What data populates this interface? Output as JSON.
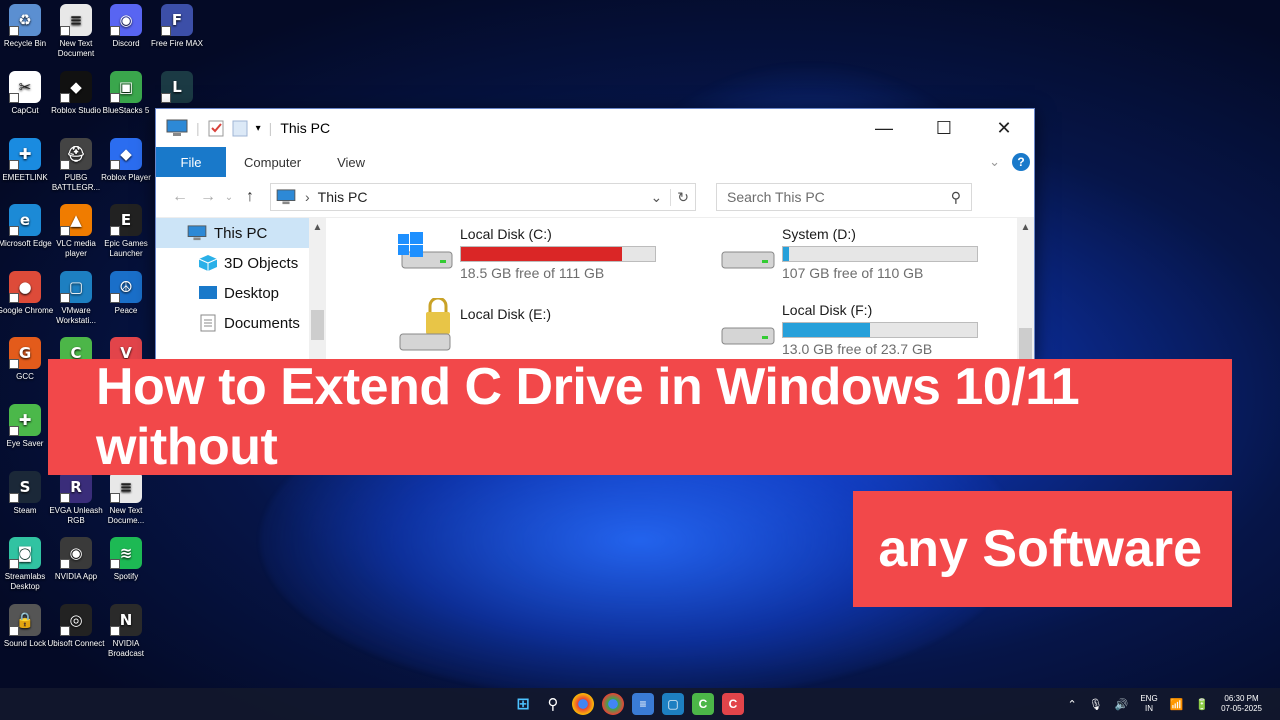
{
  "desktop": {
    "icons": [
      {
        "label": "Recycle Bin",
        "icon": "recycle-bin-icon",
        "color": "#5b8fd1",
        "glyph": "♻"
      },
      {
        "label": "New Text Document",
        "icon": "text-document-icon",
        "color": "#e8e8e8",
        "glyph": "≡"
      },
      {
        "label": "Discord",
        "icon": "discord-icon",
        "color": "#5865f2",
        "glyph": "◉"
      },
      {
        "label": "Free Fire MAX",
        "icon": "free-fire-icon",
        "color": "#3c4fa8",
        "glyph": "F"
      },
      {
        "label": "CapCut",
        "icon": "capcut-icon",
        "color": "#ffffff",
        "glyph": "✂"
      },
      {
        "label": "Roblox Studio",
        "icon": "roblox-studio-icon",
        "color": "#111111",
        "glyph": "◆"
      },
      {
        "label": "BlueStacks 5",
        "icon": "bluestacks-icon",
        "color": "#3aa64c",
        "glyph": "▣"
      },
      {
        "label": "",
        "icon": "league-icon",
        "color": "#1b3a44",
        "glyph": "L"
      },
      {
        "label": "EMEETLINK",
        "icon": "emeetlink-icon",
        "color": "#1a8be0",
        "glyph": "✚"
      },
      {
        "label": "PUBG BATTLEGR...",
        "icon": "pubg-icon",
        "color": "#444444",
        "glyph": "⛑"
      },
      {
        "label": "Roblox Player",
        "icon": "roblox-player-icon",
        "color": "#2b6df0",
        "glyph": "◆"
      },
      {
        "label": "Microsoft Edge",
        "icon": "edge-icon",
        "color": "#1c8ad6",
        "glyph": "e"
      },
      {
        "label": "VLC media player",
        "icon": "vlc-icon",
        "color": "#f07c00",
        "glyph": "▲"
      },
      {
        "label": "Epic Games Launcher",
        "icon": "epic-games-icon",
        "color": "#222222",
        "glyph": "E"
      },
      {
        "label": "Google Chrome",
        "icon": "chrome-icon",
        "color": "#dd4b39",
        "glyph": "●"
      },
      {
        "label": "VMware Workstati...",
        "icon": "vmware-icon",
        "color": "#1d7fc1",
        "glyph": "▢"
      },
      {
        "label": "Peace",
        "icon": "peace-icon",
        "color": "#1a6fc9",
        "glyph": "☮"
      },
      {
        "label": "GCC",
        "icon": "gcc-icon",
        "color": "#e35b1b",
        "glyph": "G"
      },
      {
        "label": "",
        "icon": "camtasia-icon",
        "color": "#4cb648",
        "glyph": "C"
      },
      {
        "label": "",
        "icon": "valorant-icon",
        "color": "#e2444a",
        "glyph": "V"
      },
      {
        "label": "Eye Saver",
        "icon": "eye-saver-icon",
        "color": "#4bb84a",
        "glyph": "✚"
      },
      {
        "label": "Steam",
        "icon": "steam-icon",
        "color": "#1b2838",
        "glyph": "S"
      },
      {
        "label": "EVGA Unleash RGB",
        "icon": "evga-icon",
        "color": "#3a2d7a",
        "glyph": "R"
      },
      {
        "label": "New Text Docume...",
        "icon": "text-document-icon",
        "color": "#e8e8e8",
        "glyph": "≡"
      },
      {
        "label": "Streamlabs Desktop",
        "icon": "streamlabs-icon",
        "color": "#31c3a2",
        "glyph": "◙"
      },
      {
        "label": "NVIDIA App",
        "icon": "nvidia-icon",
        "color": "#3a3a3a",
        "glyph": "◉"
      },
      {
        "label": "Spotify",
        "icon": "spotify-icon",
        "color": "#1db954",
        "glyph": "≋"
      },
      {
        "label": "Sound Lock",
        "icon": "sound-lock-icon",
        "color": "#555555",
        "glyph": "🔒"
      },
      {
        "label": "Ubisoft Connect",
        "icon": "ubisoft-icon",
        "color": "#222222",
        "glyph": "◎"
      },
      {
        "label": "NVIDIA Broadcast",
        "icon": "nvidia-broadcast-icon",
        "color": "#2a2a2a",
        "glyph": "N"
      }
    ]
  },
  "explorer": {
    "title": "This PC",
    "ribbon": {
      "file": "File",
      "computer": "Computer",
      "view": "View",
      "help": "?"
    },
    "address": {
      "path": "This PC"
    },
    "search": {
      "placeholder": "Search This PC"
    },
    "navpane": [
      "This PC",
      "3D Objects",
      "Desktop",
      "Documents"
    ],
    "drives": [
      {
        "name": "Local Disk (C:)",
        "free": "18.5 GB free of 111 GB",
        "used_fraction": 0.83,
        "bar_color": "#da2626"
      },
      {
        "name": "System (D:)",
        "free": "107 GB free of 110 GB",
        "used_fraction": 0.03,
        "bar_color": "#26a0da"
      },
      {
        "name": "Local Disk (E:)",
        "free": "",
        "used_fraction": null,
        "bar_color": ""
      },
      {
        "name": "Local Disk (F:)",
        "free": "13.0 GB free of 23.7 GB",
        "used_fraction": 0.45,
        "bar_color": "#26a0da"
      }
    ]
  },
  "banner": {
    "line1": "How to Extend C Drive in Windows 10/11 without",
    "line2": "any Software"
  },
  "taskbar": {
    "lang_top": "ENG",
    "lang_bottom": "IN",
    "time": "06:30 PM",
    "date": "07-05-2025"
  },
  "colors": {
    "accent": "#1979ca",
    "banner": "#f2484a"
  }
}
